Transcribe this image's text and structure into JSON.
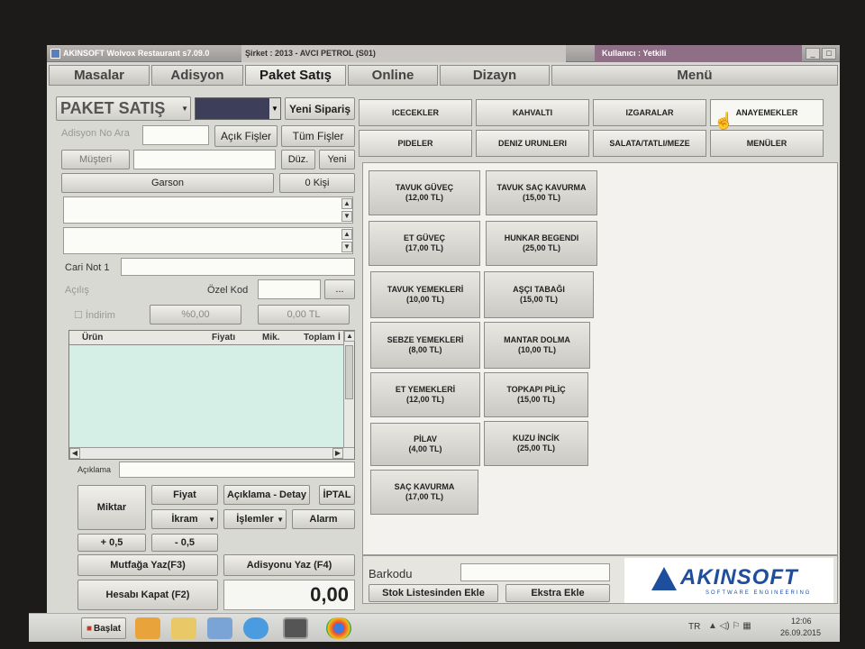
{
  "window": {
    "title": "AKINSOFT Wolvox Restaurant s7.09.0",
    "company": "Şirket : 2013 - AVCI PETROL (S01)",
    "user": "Kullanıcı : Yetkili",
    "controls": [
      "_",
      "□"
    ]
  },
  "tabs": [
    {
      "label": "Masalar"
    },
    {
      "label": "Adisyon"
    },
    {
      "label": "Paket Satış"
    },
    {
      "label": "Online"
    },
    {
      "label": "Dizayn"
    },
    {
      "label": "Menü"
    }
  ],
  "left": {
    "mode_label": "PAKET SATIŞ",
    "new_order": "Yeni Sipariş",
    "adisyon_search_label": "Adisyon No Ara",
    "open_bills": "Açık Fişler",
    "all_bills": "Tüm Fişler",
    "customer": "Müşteri",
    "edit": "Düz.",
    "new": "Yeni",
    "waiter": "Garson",
    "persons": "0 Kişi",
    "cari_note_label": "Cari Not 1",
    "opening_label": "Açılış",
    "special_code_label": "Özel Kod",
    "ellipsis": "...",
    "discount_label": "İndirim",
    "discount_percent": "%0,00",
    "discount_amount": "0,00 TL",
    "table_headers": [
      "Ürün",
      "Fiyatı",
      "Mik.",
      "Toplam",
      "İ"
    ],
    "description_label": "Açıklama",
    "btn_quantity": "Miktar",
    "btn_price": "Fiyat",
    "btn_desc_detail": "Açıklama - Detay",
    "btn_cancel": "İPTAL",
    "btn_treat": "İkram",
    "btn_operations": "İşlemler",
    "btn_alarm": "Alarm",
    "btn_plus": "+ 0,5",
    "btn_minus": "- 0,5",
    "btn_kitchen": "Mutfağa Yaz(F3)",
    "btn_print_bill": "Adisyonu Yaz (F4)",
    "btn_close_bill": "Hesabı Kapat (F2)",
    "total": "0,00"
  },
  "categories": {
    "row1": [
      "ICECEKLER",
      "KAHVALTI",
      "IZGARALAR",
      "ANAYEMEKLER"
    ],
    "row2": [
      "PIDELER",
      "DENIZ URUNLERI",
      "SALATA/TATLI/MEZE",
      "MENÜLER"
    ]
  },
  "products": [
    {
      "name": "TAVUK GÜVEÇ",
      "price": "(12,00 TL)"
    },
    {
      "name": "TAVUK SAÇ KAVURMA",
      "price": "(15,00 TL)"
    },
    {
      "name": "ET GÜVEÇ",
      "price": "(17,00 TL)"
    },
    {
      "name": "HUNKAR BEGENDI",
      "price": "(25,00 TL)"
    },
    {
      "name": "TAVUK YEMEKLERİ",
      "price": "(10,00 TL)"
    },
    {
      "name": "AŞÇI TABAĞI",
      "price": "(15,00 TL)"
    },
    {
      "name": "SEBZE YEMEKLERİ",
      "price": "(8,00 TL)"
    },
    {
      "name": "MANTAR DOLMA",
      "price": "(10,00 TL)"
    },
    {
      "name": "ET YEMEKLERİ",
      "price": "(12,00 TL)"
    },
    {
      "name": "TOPKAPI PİLİÇ",
      "price": "(15,00 TL)"
    },
    {
      "name": "PİLAV",
      "price": "(4,00 TL)"
    },
    {
      "name": "KUZU İNCİK",
      "price": "(25,00 TL)"
    },
    {
      "name": "SAÇ KAVURMA",
      "price": "(17,00 TL)"
    }
  ],
  "bottom": {
    "barcode_label": "Barkodu",
    "add_from_stock": "Stok Listesinden Ekle",
    "extra_add": "Ekstra Ekle",
    "logo": "AKINSOFT",
    "logo_sub": "SOFTWARE ENGINEERING"
  },
  "taskbar": {
    "start": "Başlat",
    "lang": "TR",
    "time": "12:06",
    "date": "26.09.2015"
  },
  "colors": {
    "logo_blue": "#1f4f9c",
    "grid_bg": "#d6efe6"
  }
}
